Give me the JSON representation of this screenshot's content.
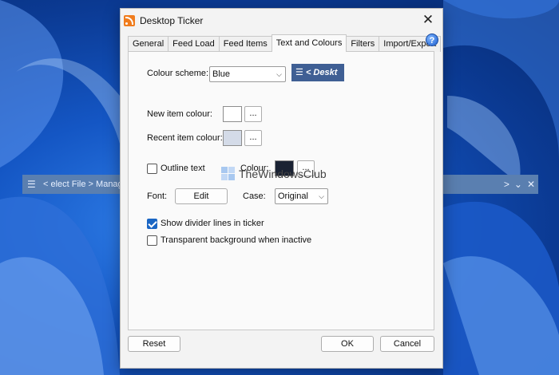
{
  "ticker": {
    "menu_icon": "hamburger-icon",
    "text": "< elect File > Manag",
    "controls": [
      "chevron-right-icon",
      "chevron-down-icon",
      "close-icon"
    ],
    "control_glyphs": [
      ">",
      "⌄",
      "✕"
    ]
  },
  "dialog": {
    "title": "Desktop Ticker",
    "close_glyph": "✕",
    "help_glyph": "?",
    "tabs": [
      {
        "label": "General",
        "active": false
      },
      {
        "label": "Feed Load",
        "active": false
      },
      {
        "label": "Feed Items",
        "active": false
      },
      {
        "label": "Text and Colours",
        "active": true
      },
      {
        "label": "Filters",
        "active": false
      },
      {
        "label": "Import/Export",
        "active": false
      }
    ],
    "colour_scheme": {
      "label": "Colour scheme:",
      "value": "Blue",
      "preview_menu": "☰",
      "preview_text": "< Deskt"
    },
    "new_item_colour": {
      "label": "New item colour:",
      "swatch": "#ffffff",
      "button": "..."
    },
    "recent_item_colour": {
      "label": "Recent item colour:",
      "swatch": "#d4dbe8",
      "button": "..."
    },
    "outline_text": {
      "label": "Outline text",
      "checked": false
    },
    "outline_colour": {
      "label": "Colour:",
      "swatch": "#1a2233",
      "button": "..."
    },
    "font": {
      "label": "Font:",
      "button": "Edit"
    },
    "case": {
      "label": "Case:",
      "value": "Original"
    },
    "show_divider": {
      "label": "Show divider lines in ticker",
      "checked": true
    },
    "transparent_bg": {
      "label": "Transparent background when inactive",
      "checked": false
    },
    "watermark": "TheWindowsClub",
    "footer": {
      "reset": "Reset",
      "ok": "OK",
      "cancel": "Cancel"
    }
  },
  "colors": {
    "accent": "#1a66c4",
    "ticker_bg": "#5a7fb0",
    "preview_bg": "#3f5f94"
  }
}
